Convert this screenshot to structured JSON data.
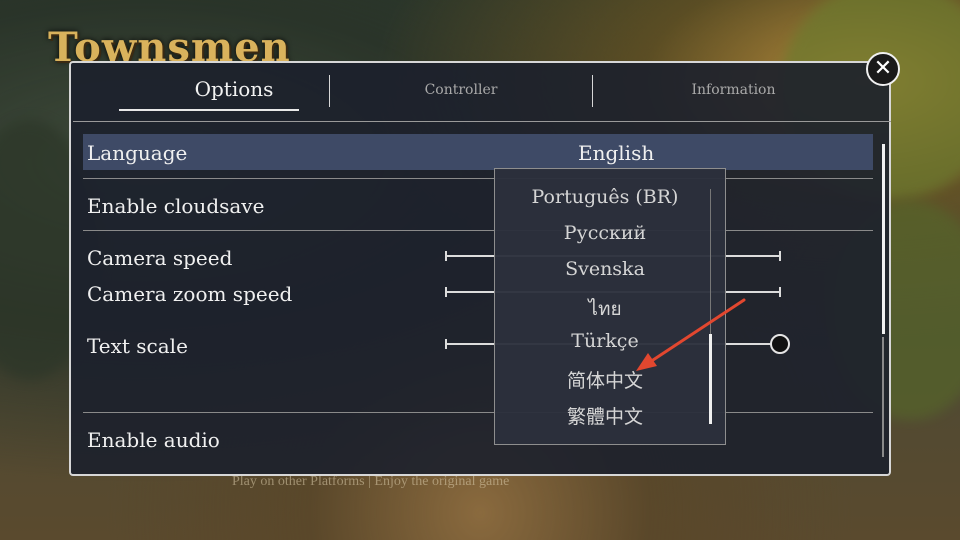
{
  "game": {
    "logo": "Townsmen"
  },
  "background_hint": "Play on other Platforms | Enjoy the original game",
  "tabs": {
    "options": "Options",
    "controller": "Controller",
    "information": "Information"
  },
  "close": {
    "icon": "close-icon",
    "glyph": "✕"
  },
  "settings": {
    "language": {
      "label": "Language",
      "value": "English"
    },
    "cloudsave": {
      "label": "Enable cloudsave"
    },
    "camera_speed": {
      "label": "Camera speed"
    },
    "camera_zoom_speed": {
      "label": "Camera zoom speed"
    },
    "text_scale": {
      "label": "Text scale",
      "level": 1.0
    },
    "audio": {
      "label": "Enable audio"
    }
  },
  "language_dropdown": {
    "options": [
      "Português (BR)",
      "Русский",
      "Svenska",
      "ไทย",
      "Türkçe",
      "简体中文",
      "繁體中文"
    ]
  },
  "annotation": {
    "color": "#e2472f",
    "points_to": "简体中文"
  },
  "colors": {
    "panel_bg": "#1c202c",
    "highlight_row": "#3e4a66",
    "text": "#f0f0f0",
    "logo": "#d9b25c"
  }
}
